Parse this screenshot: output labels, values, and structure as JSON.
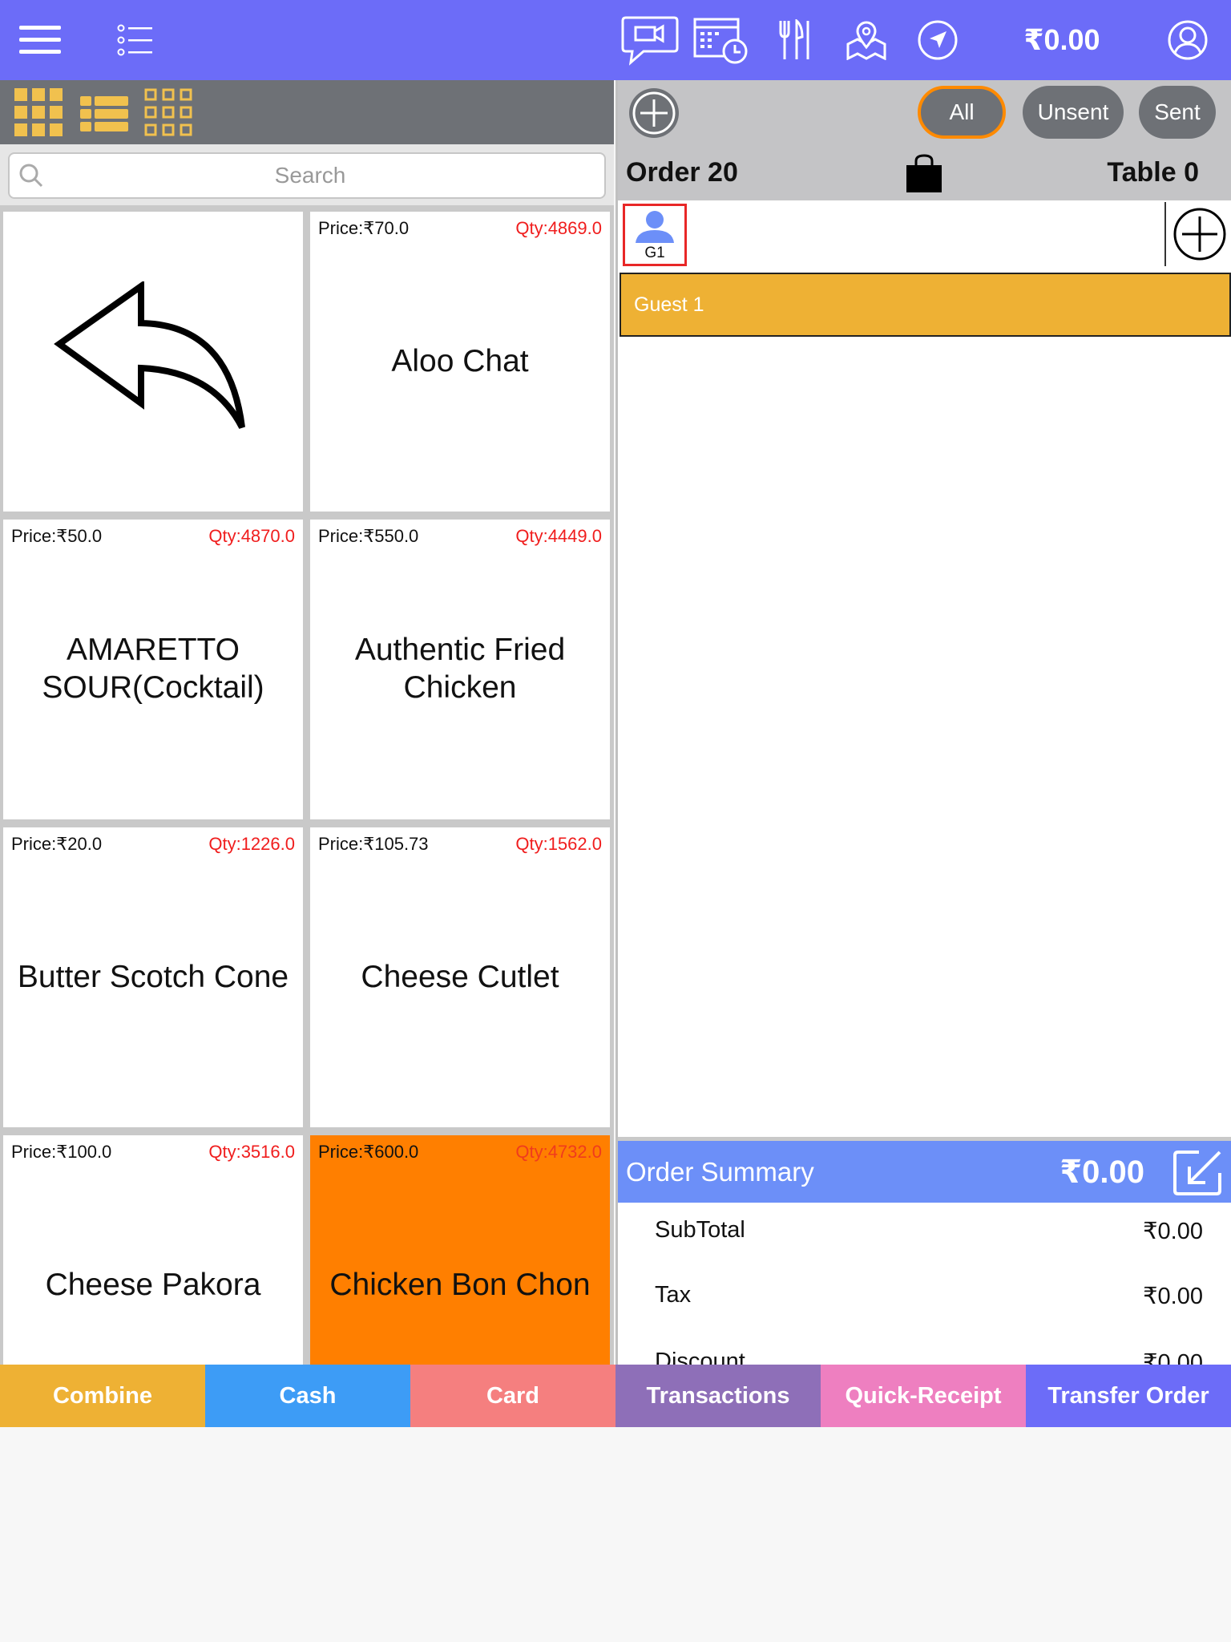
{
  "topbar": {
    "icons": [
      "menu-icon",
      "list-icon",
      "chat-video-icon",
      "calendar-clock-icon",
      "dining-icon",
      "map-pin-icon",
      "navigation-icon",
      "profile-icon"
    ],
    "total": "₹0.00",
    "color": "#6c6cf8"
  },
  "view_modes": [
    "grid-large-icon",
    "list-view-icon",
    "grid-small-icon"
  ],
  "search": {
    "placeholder": "Search"
  },
  "products": [
    {
      "name": "Aloo Chat",
      "price": "Price:₹70.0",
      "qty": "Qty:4869.0"
    },
    {
      "name": "AMARETTO SOUR(Cocktail)",
      "price": "Price:₹50.0",
      "qty": "Qty:4870.0"
    },
    {
      "name": "Authentic Fried Chicken",
      "price": "Price:₹550.0",
      "qty": "Qty:4449.0"
    },
    {
      "name": "Butter Scotch Cone",
      "price": "Price:₹20.0",
      "qty": "Qty:1226.0"
    },
    {
      "name": "Cheese Cutlet",
      "price": "Price:₹105.73",
      "qty": "Qty:1562.0"
    },
    {
      "name": "Cheese Pakora",
      "price": "Price:₹100.0",
      "qty": "Qty:3516.0"
    },
    {
      "name": "Chicken Bon Chon",
      "price": "Price:₹600.0",
      "qty": "Qty:4732.0"
    }
  ],
  "filters": {
    "all": "All",
    "unsent": "Unsent",
    "sent": "Sent"
  },
  "order": {
    "number": "Order 20",
    "table": "Table 0",
    "guest_chip": "G1",
    "guest_row": "Guest 1"
  },
  "summary": {
    "title": "Order Summary",
    "total": "₹0.00",
    "rows": [
      {
        "label": "SubTotal",
        "value": "₹0.00"
      },
      {
        "label": "Tax",
        "value": "₹0.00"
      },
      {
        "label": "Discount",
        "value": "₹0.00"
      }
    ]
  },
  "actions": [
    {
      "label": "Combine",
      "color": "#eeb134"
    },
    {
      "label": "Cash",
      "color": "#3d9cf6"
    },
    {
      "label": "Card",
      "color": "#f57f7f"
    },
    {
      "label": "Transactions",
      "color": "#8e6fb8"
    },
    {
      "label": "Quick-Receipt",
      "color": "#ee7fc0"
    },
    {
      "label": "Transfer Order",
      "color": "#6c6cf8"
    }
  ]
}
